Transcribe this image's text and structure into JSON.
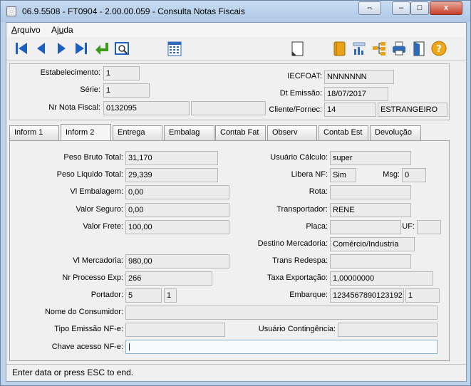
{
  "window": {
    "title": "06.9.5508 - FT0904 - 2.00.00.059 - Consulta Notas Fiscais",
    "btn_restore": "⇔",
    "btn_minimize": "–",
    "btn_maximize": "□",
    "btn_close": "x"
  },
  "menu": {
    "file_prefix": "A",
    "file_rest": "rquivo",
    "help_prefix": "Aj",
    "help_underline": "u",
    "help_rest": "da"
  },
  "toolbar": {
    "icons": [
      "first-record-icon",
      "previous-record-icon",
      "next-record-icon",
      "last-record-icon",
      "go-to-icon",
      "search-icon",
      "calendar-icon",
      "new-document-icon",
      "notes-icon",
      "chart-icon",
      "tree-icon",
      "print-icon",
      "exit-icon",
      "help-icon"
    ]
  },
  "header": {
    "establecimento_label": "Estabelecimento:",
    "establecimento_value": "1",
    "serie_label": "Série:",
    "serie_value": "1",
    "nr_nota_label": "Nr Nota Fiscal:",
    "nr_nota_value": "0132095",
    "nr_nota_extra": "",
    "iecfoat_label": "IECFOAT:",
    "iecfoat_value": "NNNNNNN",
    "dt_emissao_label": "Dt Emissão:",
    "dt_emissao_value": "18/07/2017",
    "cliente_label": "Cliente/Fornec:",
    "cliente_code": "14",
    "cliente_name": "ESTRANGEIRO"
  },
  "tabs": [
    "Inform 1",
    "Inform 2",
    "Entrega",
    "Embalag",
    "Contab Fat",
    "Observ",
    "Contab Est",
    "Devolução"
  ],
  "fields": {
    "peso_bruto_label": "Peso Bruto Total:",
    "peso_bruto": "31,170",
    "peso_liquido_label": "Peso Líquido Total:",
    "peso_liquido": "29,339",
    "vl_embalagem_label": "Vl Embalagem:",
    "vl_embalagem": "0,00",
    "valor_seguro_label": "Valor Seguro:",
    "valor_seguro": "0,00",
    "valor_frete_label": "Valor Frete:",
    "valor_frete": "100,00",
    "vl_mercadoria_label": "Vl Mercadoria:",
    "vl_mercadoria": "980,00",
    "nr_processo_label": "Nr Processo Exp:",
    "nr_processo": "266",
    "portador_label": "Portador:",
    "portador": "5",
    "portador_mod": "1",
    "nome_consumidor_label": "Nome do Consumidor:",
    "nome_consumidor": "",
    "tipo_emissao_label": "Tipo Emissão NF-e:",
    "tipo_emissao": "",
    "chave_acesso_label": "Chave acesso NF-e:",
    "chave_acesso": "|",
    "usuario_calculo_label": "Usuário Cálculo:",
    "usuario_calculo": "super",
    "libera_nf_label": "Libera NF:",
    "libera_nf": "Sim",
    "msg_label": "Msg:",
    "msg": "0",
    "rota_label": "Rota:",
    "rota": "",
    "transportador_label": "Transportador:",
    "transportador": "RENE",
    "placa_label": "Placa:",
    "placa": "",
    "uf_label": "UF:",
    "uf": "",
    "destino_label": "Destino Mercadoria:",
    "destino": "Comércio/Industria",
    "trans_redespa_label": "Trans Redespa:",
    "trans_redespa": "",
    "taxa_exportacao_label": "Taxa Exportação:",
    "taxa_exportacao": "1,00000000",
    "embarque_label": "Embarque:",
    "embarque": "1234567890123192",
    "embarque_seq": "1",
    "usuario_contingencia_label": "Usuário Contingência:",
    "usuario_contingencia": ""
  },
  "status": "Enter data or press ESC to end."
}
